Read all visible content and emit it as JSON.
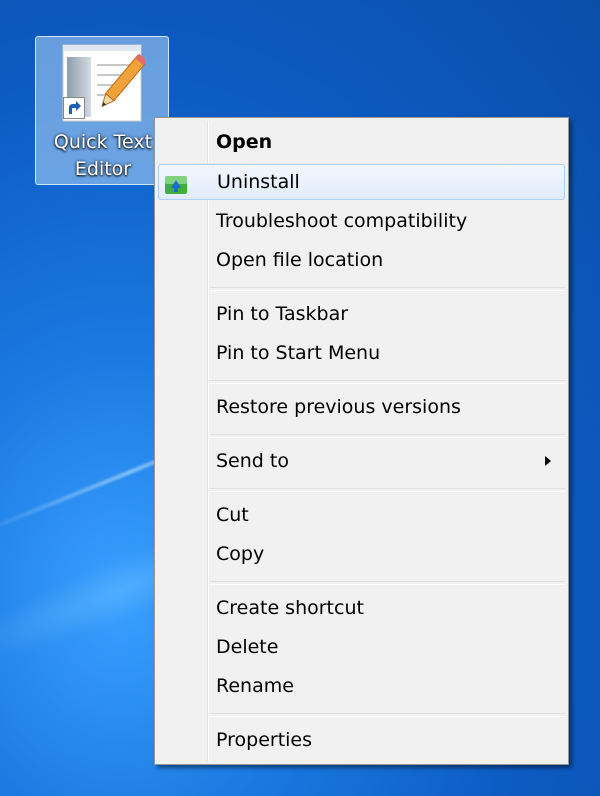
{
  "desktop_icon": {
    "label_line1": "Quick Text",
    "label_line2": "Editor"
  },
  "menu": {
    "groups": [
      [
        {
          "label": "Open",
          "bold": true
        },
        {
          "label": "Uninstall",
          "icon": "uninstall-icon",
          "highlighted": true
        },
        {
          "label": "Troubleshoot compatibility"
        },
        {
          "label": "Open file location"
        }
      ],
      [
        {
          "label": "Pin to Taskbar"
        },
        {
          "label": "Pin to Start Menu"
        }
      ],
      [
        {
          "label": "Restore previous versions"
        }
      ],
      [
        {
          "label": "Send to",
          "submenu": true
        }
      ],
      [
        {
          "label": "Cut"
        },
        {
          "label": "Copy"
        }
      ],
      [
        {
          "label": "Create shortcut"
        },
        {
          "label": "Delete"
        },
        {
          "label": "Rename"
        }
      ],
      [
        {
          "label": "Properties"
        }
      ]
    ]
  }
}
